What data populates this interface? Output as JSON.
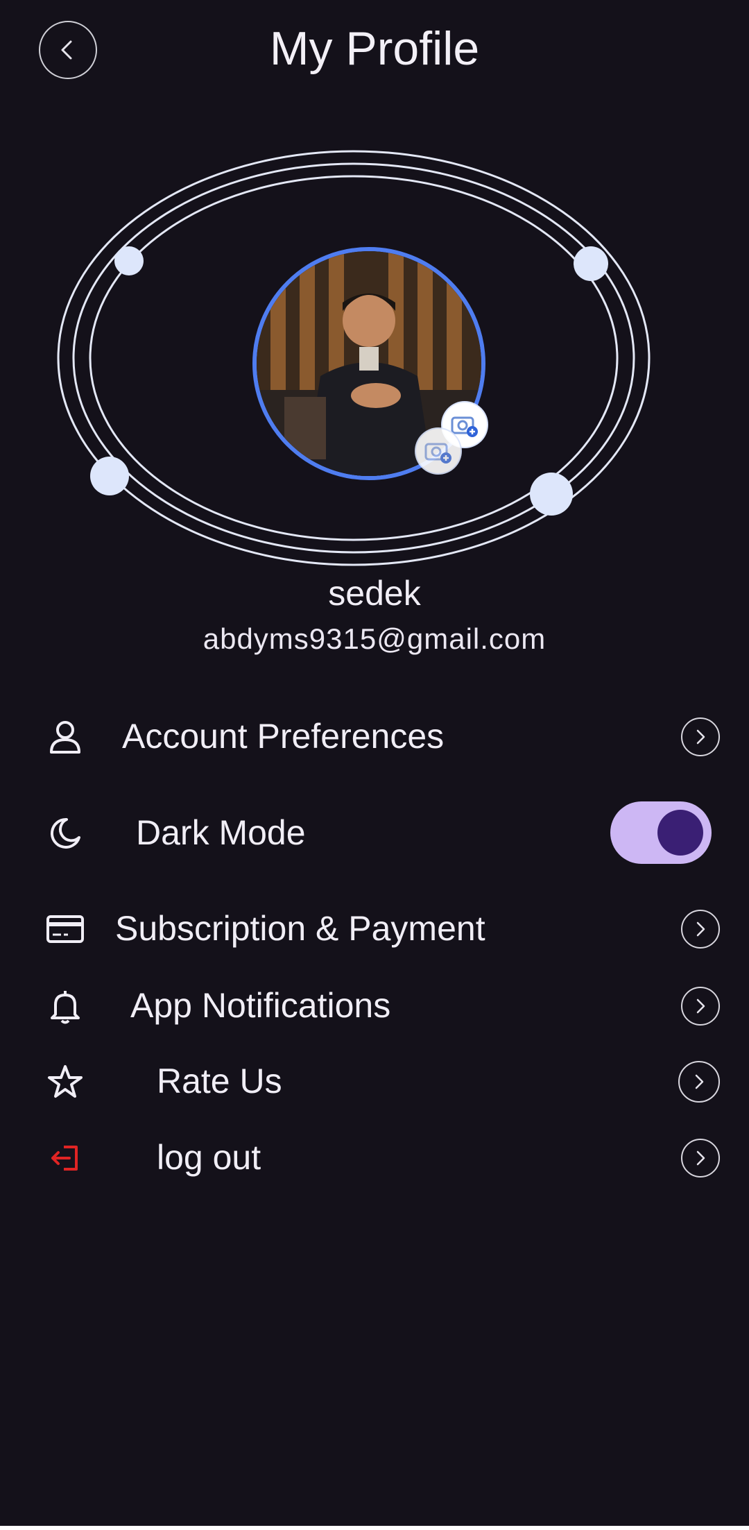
{
  "header": {
    "title": "My Profile",
    "back_icon": "chevron-left-icon"
  },
  "profile": {
    "username": "sedek",
    "email": "abdyms9315@gmail.com",
    "avatar_icon": "profile-photo",
    "camera_icon": "camera-add-icon"
  },
  "menu": {
    "account_preferences": {
      "label": "Account Preferences",
      "icon": "user-icon"
    },
    "dark_mode": {
      "label": "Dark Mode",
      "icon": "moon-icon",
      "enabled": true
    },
    "subscription": {
      "label": "Subscription & Payment",
      "icon": "credit-card-icon"
    },
    "notifications": {
      "label": "App Notifications",
      "icon": "bell-icon"
    },
    "rate_us": {
      "label": "Rate Us",
      "icon": "star-icon"
    },
    "logout": {
      "label": "log out",
      "icon": "logout-icon"
    }
  },
  "colors": {
    "background": "#14111a",
    "accent_ring": "#4f7df0",
    "toggle_track": "#cdb7f4",
    "toggle_knob": "#3a1f74",
    "logout_red": "#e02424"
  }
}
